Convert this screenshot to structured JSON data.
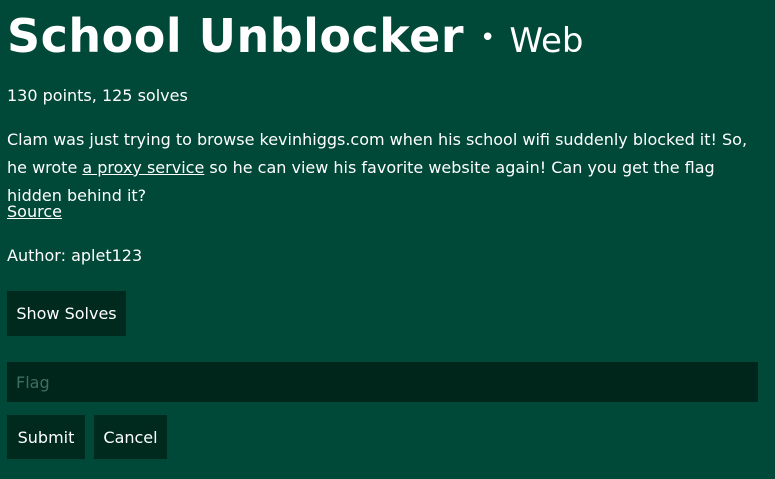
{
  "challenge": {
    "title": "School Unblocker",
    "separator": "•",
    "category": "Web",
    "meta": "130 points, 125 solves",
    "description": {
      "part1": "Clam was just trying to browse kevinhiggs.com when his school wifi suddenly blocked it! So, he wrote ",
      "link_text": "a proxy service",
      "part2": " so he can view his favorite website again! Can you get the flag hidden behind it?"
    },
    "source_label": "Source",
    "author": "Author: aplet123"
  },
  "actions": {
    "show_solves_label": "Show Solves",
    "flag_placeholder": "Flag",
    "flag_value": "",
    "submit_label": "Submit",
    "cancel_label": "Cancel"
  },
  "colors": {
    "background": "#004837",
    "button": "#002a1e",
    "input": "#00251a",
    "text": "#ffffff"
  }
}
